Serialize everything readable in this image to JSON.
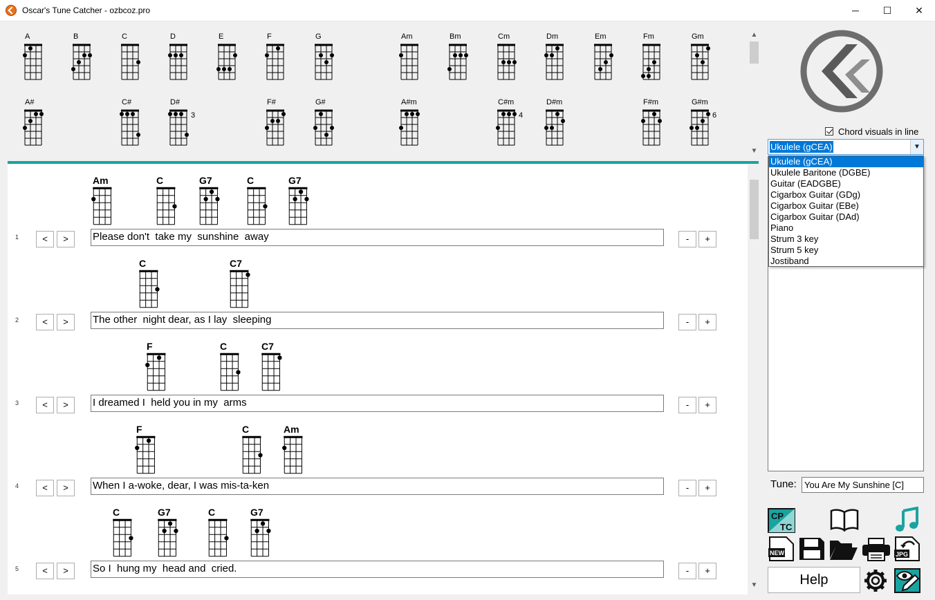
{
  "window": {
    "title": "Oscar's Tune Catcher   -   ozbcoz.pro",
    "minimize_glyph": "─",
    "maximize_glyph": "☐",
    "close_glyph": "✕"
  },
  "palette": {
    "major_row": [
      {
        "name": "A",
        "dots": [
          [
            1,
            1
          ],
          [
            0,
            2
          ]
        ]
      },
      {
        "name": "B",
        "dots": [
          [
            3,
            2
          ],
          [
            2,
            2
          ],
          [
            1,
            3
          ],
          [
            0,
            4
          ]
        ]
      },
      {
        "name": "C",
        "dots": [
          [
            3,
            3
          ]
        ]
      },
      {
        "name": "D",
        "dots": [
          [
            0,
            2
          ],
          [
            1,
            2
          ],
          [
            2,
            2
          ]
        ]
      },
      {
        "name": "E",
        "dots": [
          [
            3,
            2
          ],
          [
            0,
            4
          ],
          [
            1,
            4
          ],
          [
            2,
            4
          ]
        ]
      },
      {
        "name": "F",
        "dots": [
          [
            2,
            1
          ],
          [
            0,
            2
          ]
        ]
      },
      {
        "name": "G",
        "dots": [
          [
            1,
            2
          ],
          [
            3,
            2
          ],
          [
            2,
            3
          ]
        ]
      },
      {
        "name": "Am",
        "dots": [
          [
            0,
            2
          ]
        ]
      },
      {
        "name": "Bm",
        "dots": [
          [
            1,
            2
          ],
          [
            2,
            2
          ],
          [
            3,
            2
          ],
          [
            0,
            4
          ]
        ]
      },
      {
        "name": "Cm",
        "dots": [
          [
            1,
            3
          ],
          [
            2,
            3
          ],
          [
            3,
            3
          ]
        ]
      },
      {
        "name": "Dm",
        "dots": [
          [
            2,
            1
          ],
          [
            0,
            2
          ],
          [
            1,
            2
          ]
        ]
      },
      {
        "name": "Em",
        "dots": [
          [
            3,
            2
          ],
          [
            2,
            3
          ],
          [
            1,
            4
          ]
        ]
      },
      {
        "name": "Fm",
        "dots": [
          [
            2,
            3
          ],
          [
            1,
            4
          ],
          [
            0,
            5
          ],
          [
            1,
            5
          ]
        ]
      },
      {
        "name": "Gm",
        "dots": [
          [
            3,
            1
          ],
          [
            1,
            2
          ],
          [
            2,
            3
          ]
        ]
      }
    ],
    "sharp_row": [
      {
        "name": "A#",
        "dots": [
          [
            2,
            1
          ],
          [
            3,
            1
          ],
          [
            1,
            2
          ],
          [
            0,
            3
          ]
        ]
      },
      {
        "name": "C#",
        "dots": [
          [
            0,
            1
          ],
          [
            1,
            1
          ],
          [
            2,
            1
          ],
          [
            3,
            4
          ]
        ]
      },
      {
        "name": "D#",
        "dots": [
          [
            0,
            1
          ],
          [
            1,
            1
          ],
          [
            2,
            1
          ],
          [
            3,
            4
          ]
        ],
        "fret": "3"
      },
      {
        "name": "F#",
        "dots": [
          [
            3,
            1
          ],
          [
            1,
            2
          ],
          [
            2,
            2
          ],
          [
            0,
            3
          ]
        ]
      },
      {
        "name": "G#",
        "dots": [
          [
            1,
            1
          ],
          [
            3,
            3
          ],
          [
            0,
            3
          ],
          [
            2,
            4
          ]
        ]
      },
      {
        "name": "A#m",
        "dots": [
          [
            1,
            1
          ],
          [
            2,
            1
          ],
          [
            3,
            1
          ],
          [
            0,
            3
          ]
        ]
      },
      {
        "name": "C#m",
        "dots": [
          [
            1,
            1
          ],
          [
            2,
            1
          ],
          [
            3,
            1
          ],
          [
            0,
            3
          ]
        ],
        "fret": "4"
      },
      {
        "name": "D#m",
        "dots": [
          [
            2,
            1
          ],
          [
            0,
            3
          ],
          [
            1,
            3
          ],
          [
            3,
            2
          ]
        ]
      },
      {
        "name": "F#m",
        "dots": [
          [
            2,
            1
          ],
          [
            0,
            2
          ],
          [
            3,
            2
          ]
        ]
      },
      {
        "name": "G#m",
        "dots": [
          [
            3,
            1
          ],
          [
            1,
            3
          ],
          [
            0,
            3
          ],
          [
            2,
            2
          ]
        ],
        "fret": "6"
      }
    ]
  },
  "song": {
    "lines": [
      {
        "num": "1",
        "text": "Please don't  take my  sunshine  away",
        "chords": [
          {
            "name": "Am",
            "dots": [
              [
                0,
                2
              ]
            ]
          },
          {
            "name": "C",
            "dots": [
              [
                3,
                3
              ]
            ]
          },
          {
            "name": "G7",
            "dots": [
              [
                2,
                1
              ],
              [
                1,
                2
              ],
              [
                3,
                2
              ]
            ]
          },
          {
            "name": "C",
            "dots": [
              [
                3,
                3
              ]
            ]
          },
          {
            "name": "G7",
            "dots": [
              [
                2,
                1
              ],
              [
                1,
                2
              ],
              [
                3,
                2
              ]
            ]
          }
        ]
      },
      {
        "num": "2",
        "text": "The other  night dear, as I lay  sleeping",
        "chords": [
          {
            "name": "C",
            "dots": [
              [
                3,
                3
              ]
            ]
          },
          {
            "name": "C7",
            "dots": [
              [
                3,
                1
              ]
            ]
          }
        ]
      },
      {
        "num": "3",
        "text": "I dreamed I  held you in my  arms",
        "chords": [
          {
            "name": "F",
            "dots": [
              [
                2,
                1
              ],
              [
                0,
                2
              ]
            ]
          },
          {
            "name": "C",
            "dots": [
              [
                3,
                3
              ]
            ]
          },
          {
            "name": "C7",
            "dots": [
              [
                3,
                1
              ]
            ]
          }
        ]
      },
      {
        "num": "4",
        "text": "When I a-woke, dear, I was mis-ta-ken",
        "chords": [
          {
            "name": "F",
            "dots": [
              [
                2,
                1
              ],
              [
                0,
                2
              ]
            ]
          },
          {
            "name": "C",
            "dots": [
              [
                3,
                3
              ]
            ]
          },
          {
            "name": "Am",
            "dots": [
              [
                0,
                2
              ]
            ]
          }
        ]
      },
      {
        "num": "5",
        "text": "So I  hung my  head and  cried.",
        "chords": [
          {
            "name": "C",
            "dots": [
              [
                3,
                3
              ]
            ]
          },
          {
            "name": "G7",
            "dots": [
              [
                2,
                1
              ],
              [
                1,
                2
              ],
              [
                3,
                2
              ]
            ]
          },
          {
            "name": "C",
            "dots": [
              [
                3,
                3
              ]
            ]
          },
          {
            "name": "G7",
            "dots": [
              [
                2,
                1
              ],
              [
                1,
                2
              ],
              [
                3,
                2
              ]
            ]
          }
        ]
      }
    ],
    "prev_label": "<",
    "next_label": ">",
    "minus_label": "-",
    "plus_label": "+"
  },
  "right_panel": {
    "chord_visuals_label": "Chord visuals in line",
    "chord_visuals_checked": true,
    "instrument_selected": "Ukulele (gCEA)",
    "instrument_options": [
      "Ukulele (gCEA)",
      "Ukulele Baritone (DGBE)",
      "Guitar (EADGBE)",
      "Cigarbox Guitar (GDg)",
      "Cigarbox Guitar (EBe)",
      "Cigarbox Guitar (DAd)",
      "Piano",
      "Strum 3 key",
      "Strum 5 key",
      "Jostiband"
    ],
    "tune_label": "Tune:",
    "tune_value": "You Are My Sunshine [C]",
    "help_label": "Help",
    "cptc_top": "CP",
    "cptc_bottom": "TC",
    "new_label": "NEW",
    "jpg_label": "JPG"
  },
  "colors": {
    "accent_teal": "#1aa3a0",
    "selection_blue": "#0078d7",
    "logo_grey": "#6d6d6d"
  }
}
